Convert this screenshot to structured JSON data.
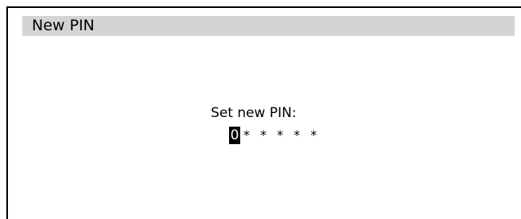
{
  "dialog": {
    "title": "New PIN",
    "prompt": "Set new PIN:"
  },
  "pin": {
    "current_digit": "0",
    "masked_digits": "* * * * *"
  }
}
